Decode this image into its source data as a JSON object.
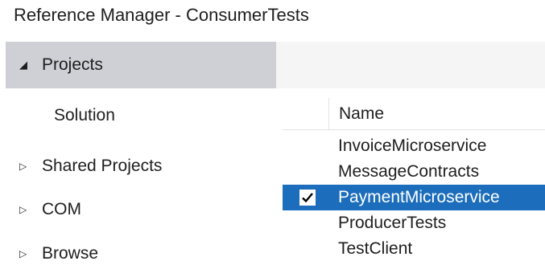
{
  "window": {
    "title": "Reference Manager - ConsumerTests"
  },
  "nav": {
    "projects": {
      "label": "Projects",
      "icon": "triangle-down-icon"
    },
    "solution": {
      "label": "Solution"
    },
    "shared_projects": {
      "label": "Shared Projects",
      "icon": "triangle-right-icon"
    },
    "com": {
      "label": "COM",
      "icon": "triangle-right-icon"
    },
    "browse": {
      "label": "Browse",
      "icon": "triangle-right-icon"
    }
  },
  "grid": {
    "columns": [
      "",
      "Name"
    ],
    "rows": [
      {
        "name": "InvoiceMicroservice",
        "checked": false,
        "selected": false
      },
      {
        "name": "MessageContracts",
        "checked": false,
        "selected": false
      },
      {
        "name": "PaymentMicroservice",
        "checked": true,
        "selected": true
      },
      {
        "name": "ProducerTests",
        "checked": false,
        "selected": false
      },
      {
        "name": "TestClient",
        "checked": false,
        "selected": false
      }
    ]
  },
  "colors": {
    "selected_row": "#1c6dbb",
    "selected_nav": "#cfcfd6",
    "toolbar_bg": "#f5f5f5"
  }
}
